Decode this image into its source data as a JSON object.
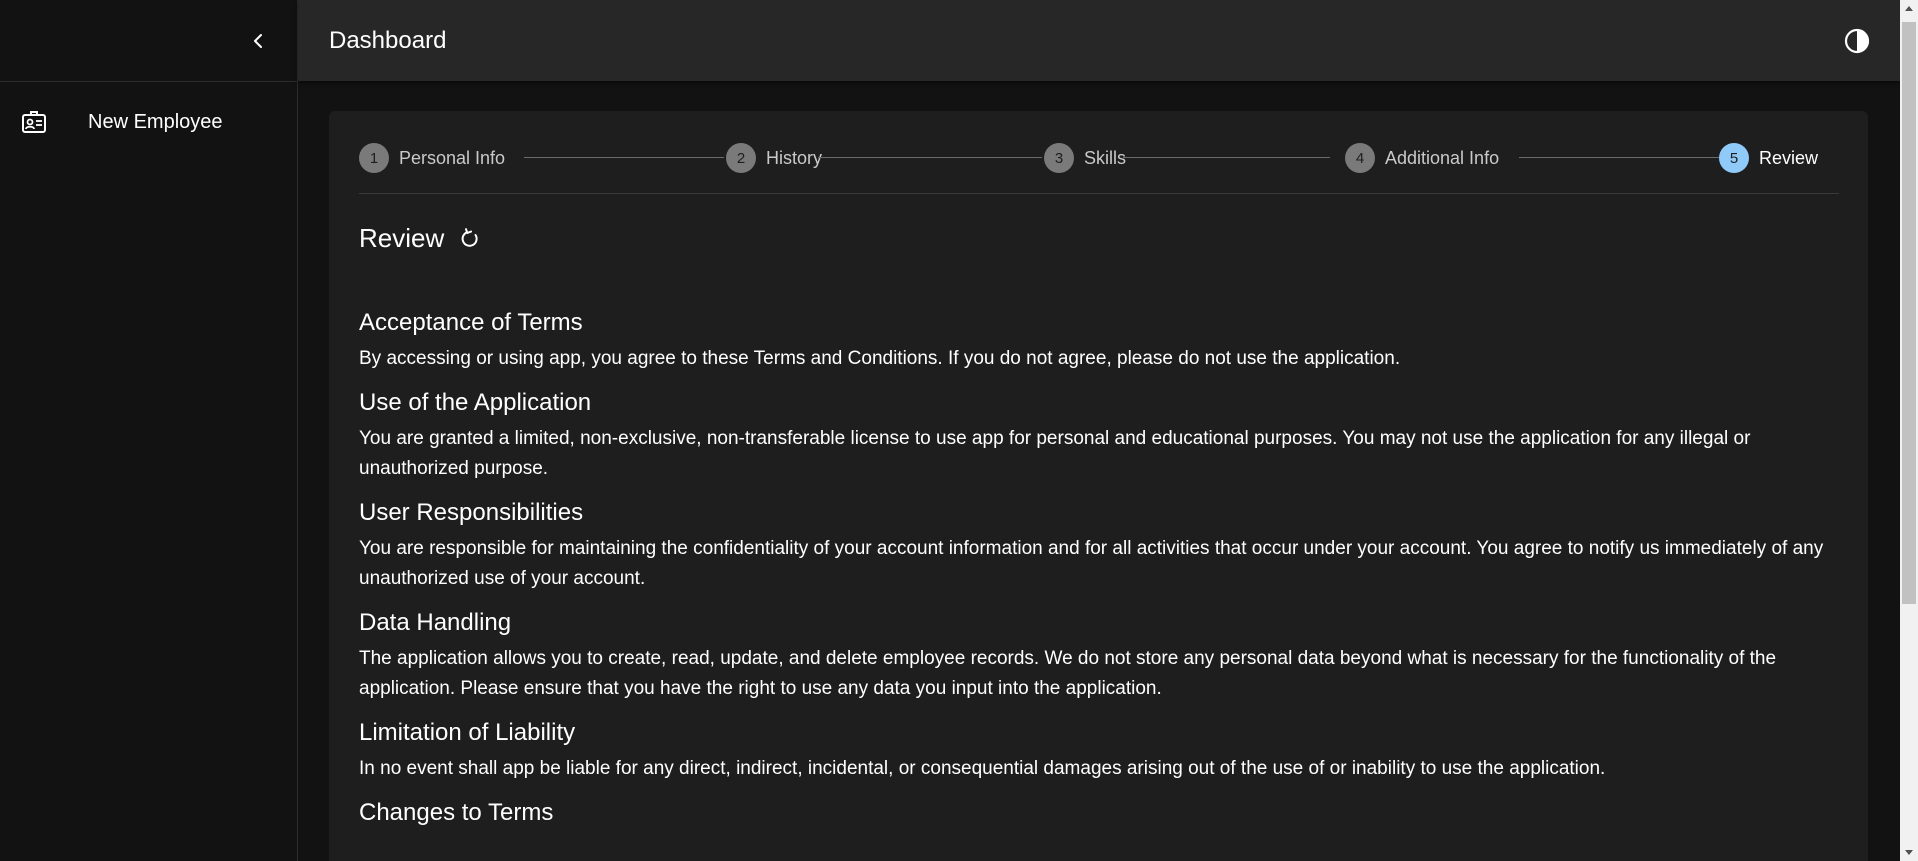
{
  "sidebar": {
    "items": [
      {
        "label": "New Employee",
        "icon": "badge-icon"
      }
    ]
  },
  "header": {
    "title": "Dashboard"
  },
  "stepper": {
    "steps": [
      {
        "number": "1",
        "label": "Personal Info"
      },
      {
        "number": "2",
        "label": "History"
      },
      {
        "number": "3",
        "label": "Skills"
      },
      {
        "number": "4",
        "label": "Additional Info"
      },
      {
        "number": "5",
        "label": "Review"
      }
    ],
    "active_step": 5
  },
  "review": {
    "title": "Review",
    "sections": [
      {
        "heading": "Acceptance of Terms",
        "body": "By accessing or using app, you agree to these Terms and Conditions. If you do not agree, please do not use the application."
      },
      {
        "heading": "Use of the Application",
        "body": "You are granted a limited, non-exclusive, non-transferable license to use app for personal and educational purposes. You may not use the application for any illegal or unauthorized purpose."
      },
      {
        "heading": "User Responsibilities",
        "body": "You are responsible for maintaining the confidentiality of your account information and for all activities that occur under your account. You agree to notify us immediately of any unauthorized use of your account."
      },
      {
        "heading": "Data Handling",
        "body": "The application allows you to create, read, update, and delete employee records. We do not store any personal data beyond what is necessary for the functionality of the application. Please ensure that you have the right to use any data you input into the application."
      },
      {
        "heading": "Limitation of Liability",
        "body": "In no event shall app be liable for any direct, indirect, incidental, or consequential damages arising out of the use of or inability to use the application."
      },
      {
        "heading": "Changes to Terms",
        "body": ""
      }
    ]
  },
  "colors": {
    "background": "#121212",
    "surface": "#1e1e1e",
    "header": "#272727",
    "accent": "#90caf9",
    "inactive_step": "#7a7a7a"
  }
}
